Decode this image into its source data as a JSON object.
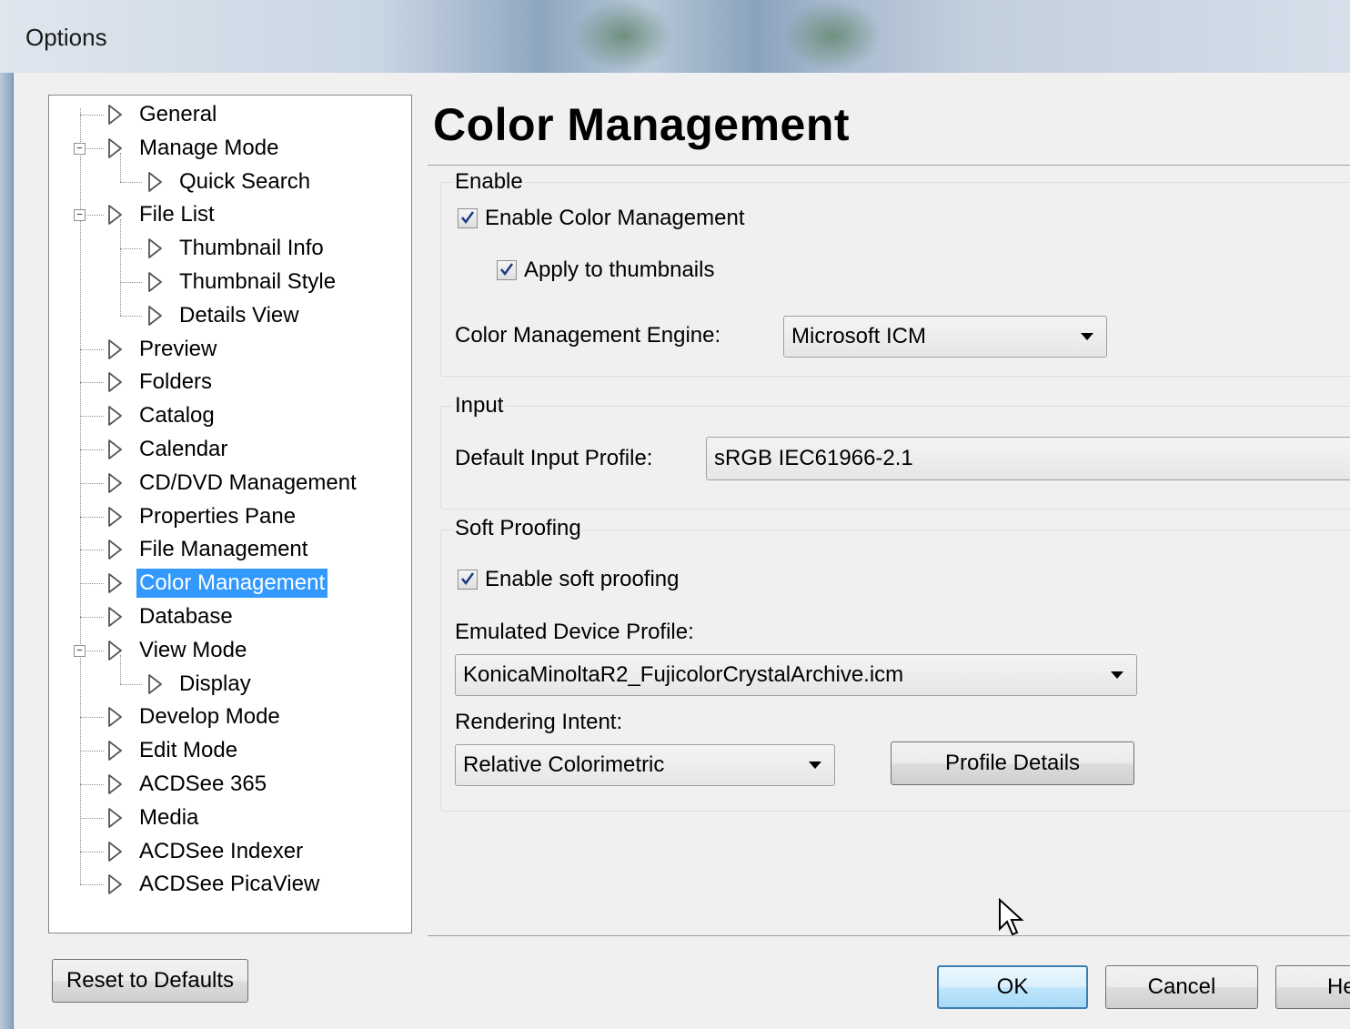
{
  "window": {
    "title": "Options"
  },
  "tree": {
    "items": [
      {
        "label": "General"
      },
      {
        "label": "Manage Mode"
      },
      {
        "label": "Quick Search"
      },
      {
        "label": "File List"
      },
      {
        "label": "Thumbnail Info"
      },
      {
        "label": "Thumbnail Style"
      },
      {
        "label": "Details View"
      },
      {
        "label": "Preview"
      },
      {
        "label": "Folders"
      },
      {
        "label": "Catalog"
      },
      {
        "label": "Calendar"
      },
      {
        "label": "CD/DVD Management"
      },
      {
        "label": "Properties Pane"
      },
      {
        "label": "File Management"
      },
      {
        "label": "Color Management"
      },
      {
        "label": "Database"
      },
      {
        "label": "View Mode"
      },
      {
        "label": "Display"
      },
      {
        "label": "Develop Mode"
      },
      {
        "label": "Edit Mode"
      },
      {
        "label": "ACDSee 365"
      },
      {
        "label": "Media"
      },
      {
        "label": "ACDSee Indexer"
      },
      {
        "label": "ACDSee PicaView"
      }
    ],
    "selected": "Color Management"
  },
  "page": {
    "title": "Color Management",
    "enable_group": {
      "legend": "Enable",
      "enable_cm_label": "Enable Color Management",
      "enable_cm_checked": true,
      "apply_thumbs_label": "Apply to thumbnails",
      "apply_thumbs_checked": true,
      "engine_label": "Color Management Engine:",
      "engine_value": "Microsoft ICM"
    },
    "input_group": {
      "legend": "Input",
      "default_profile_label": "Default Input Profile:",
      "default_profile_value": "sRGB IEC61966-2.1"
    },
    "soft_group": {
      "legend": "Soft Proofing",
      "enable_soft_label": "Enable soft proofing",
      "enable_soft_checked": true,
      "emulated_label": "Emulated Device Profile:",
      "emulated_value": "KonicaMinoltaR2_FujicolorCrystalArchive.icm",
      "intent_label": "Rendering Intent:",
      "intent_value": "Relative Colorimetric",
      "profile_details_label": "Profile Details"
    }
  },
  "footer": {
    "reset_label": "Reset to Defaults",
    "ok_label": "OK",
    "cancel_label": "Cancel",
    "help_label": "He"
  }
}
